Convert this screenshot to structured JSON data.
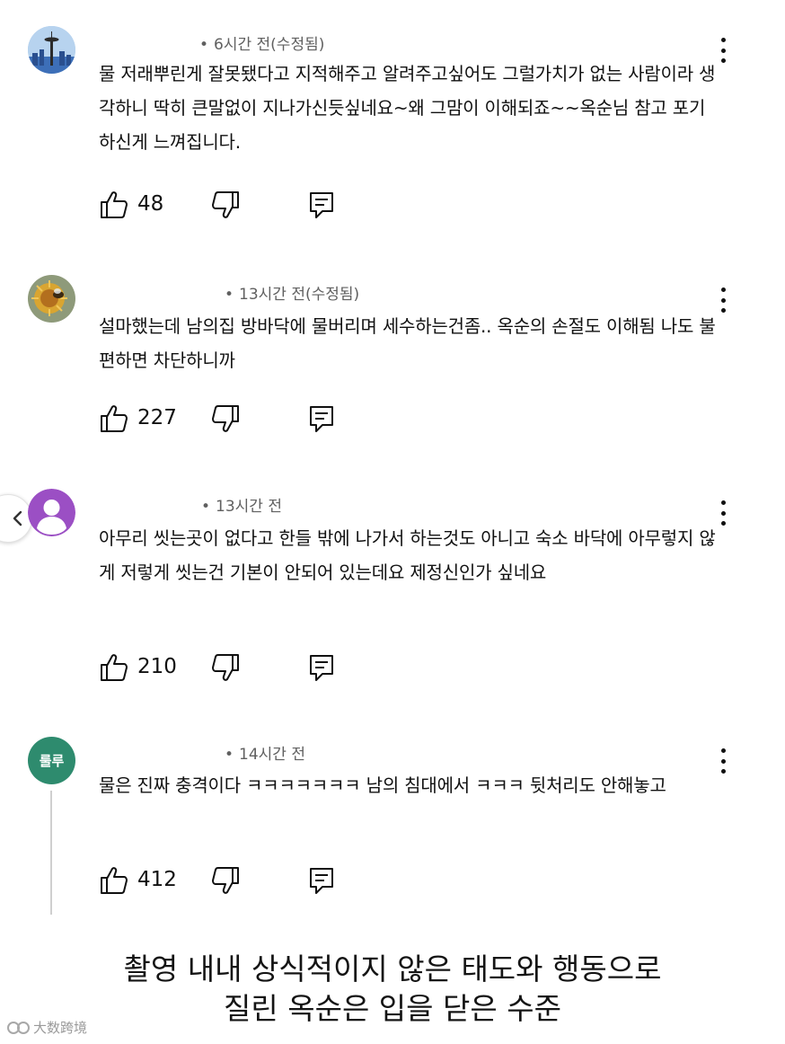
{
  "comments": [
    {
      "author": "",
      "time": "6시간 전(수정됨)",
      "text": "물 저래뿌린게 잘못됐다고 지적해주고 알려주고싶어도 그럴가치가 없는 사람이라 생각하니 딱히 큰말없이 지나가신듯싶네요~왜 그맘이 이해되죠~~옥순님 참고 포기하신게 느껴집니다.",
      "likes": "48",
      "avatar_icon": "space-needle-avatar-icon"
    },
    {
      "author": "",
      "time": "13시간 전(수정됨)",
      "text": "설마했는데 남의집 방바닥에 물버리며 세수하는건좀..  옥순의 손절도 이해됨 나도 불편하면 차단하니까",
      "likes": "227",
      "avatar_icon": "flower-bee-avatar-icon"
    },
    {
      "author": "",
      "time": "13시간 전",
      "text": "아무리 씻는곳이 없다고 한들 밖에 나가서 하는것도 아니고 숙소 바닥에 아무렇지 않게 저렇게 씻는건 기본이 안되어 있는데요 제정신인가 싶네요",
      "likes": "210",
      "avatar_icon": "default-user-avatar-icon"
    },
    {
      "author": "",
      "time": "14시간 전",
      "text": "물은 진짜 충격이다 ㅋㅋㅋㅋㅋㅋㅋ 남의 침대에서 ㅋㅋㅋ 뒷처리도 안해놓고",
      "likes": "412",
      "avatar_text": "룰루"
    }
  ],
  "caption": {
    "line1": "촬영 내내 상식적이지 않은 태도와 행동으로",
    "line2": "질린 옥순은 입을 닫은 수준"
  },
  "watermark": "大数跨境",
  "colors": {
    "avatar_purple": "#9b4fc4",
    "avatar_green": "#2e8b6e",
    "meta_gray": "#606060",
    "thread_line": "#cfcfcf"
  }
}
